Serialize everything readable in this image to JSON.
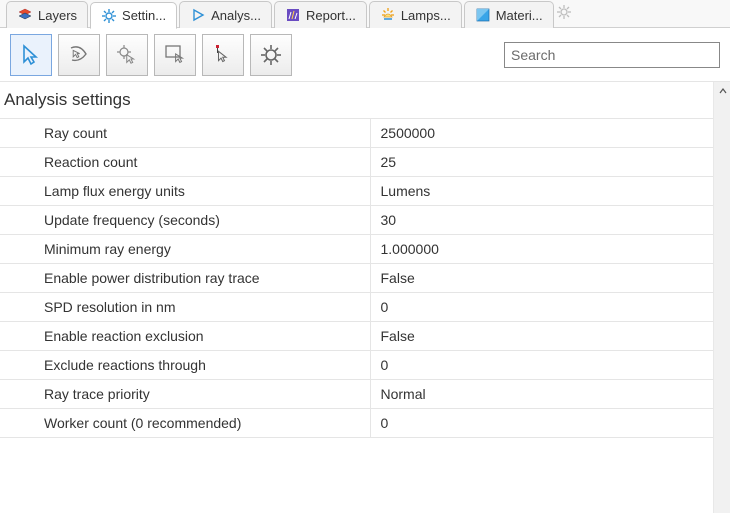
{
  "tabs": [
    {
      "label": "Layers"
    },
    {
      "label": "Settin..."
    },
    {
      "label": "Analys..."
    },
    {
      "label": "Report..."
    },
    {
      "label": "Lamps..."
    },
    {
      "label": "Materi..."
    }
  ],
  "search": {
    "placeholder": "Search"
  },
  "section_title": "Analysis settings",
  "settings": [
    {
      "label": "Ray count",
      "value": "2500000"
    },
    {
      "label": "Reaction count",
      "value": "25"
    },
    {
      "label": "Lamp flux energy units",
      "value": "Lumens"
    },
    {
      "label": "Update frequency (seconds)",
      "value": "30"
    },
    {
      "label": "Minimum ray energy",
      "value": "1.000000"
    },
    {
      "label": "Enable power distribution ray trace",
      "value": "False"
    },
    {
      "label": "SPD resolution in nm",
      "value": "0"
    },
    {
      "label": "Enable reaction exclusion",
      "value": "False"
    },
    {
      "label": "Exclude reactions through",
      "value": "0"
    },
    {
      "label": "Ray trace priority",
      "value": "Normal"
    },
    {
      "label": "Worker count (0 recommended)",
      "value": "0"
    }
  ]
}
